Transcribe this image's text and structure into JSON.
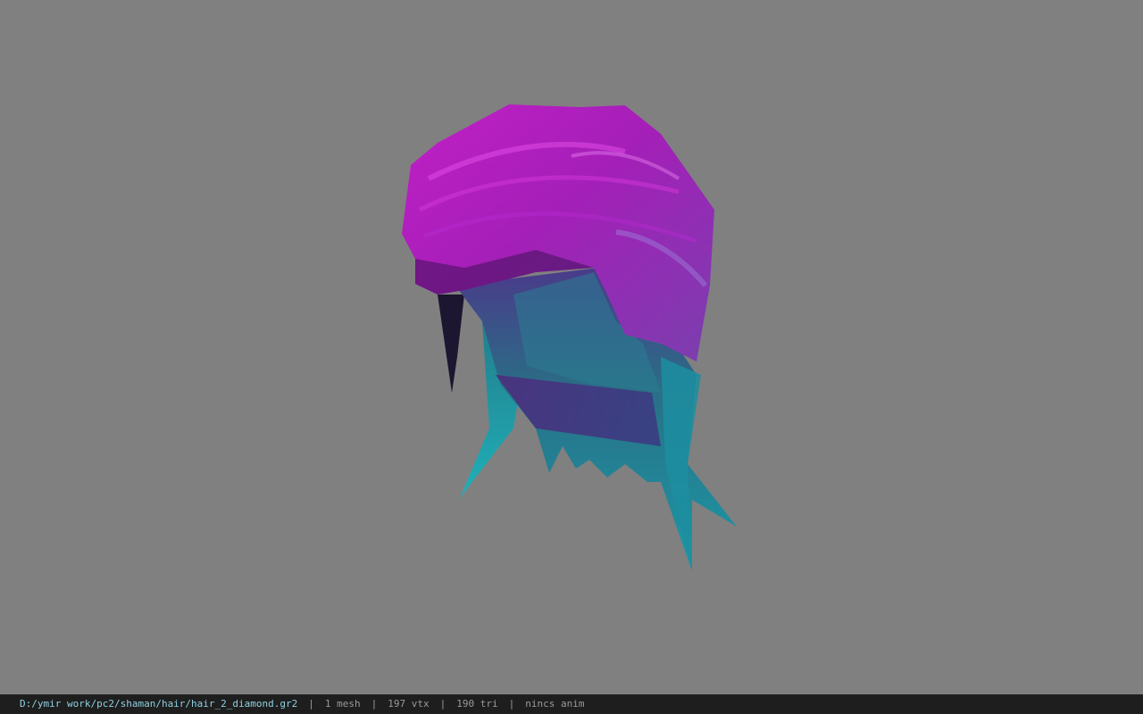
{
  "viewport": {
    "background_color": "#808080",
    "model": "hair-mesh"
  },
  "statusbar": {
    "file_path": "D:/ymir work/pc2/shaman/hair/hair_2_diamond.gr2",
    "mesh_count": "1 mesh",
    "vertex_count": "197 vtx",
    "triangle_count": "190 tri",
    "anim_info": "nincs anim",
    "separator": "|"
  }
}
